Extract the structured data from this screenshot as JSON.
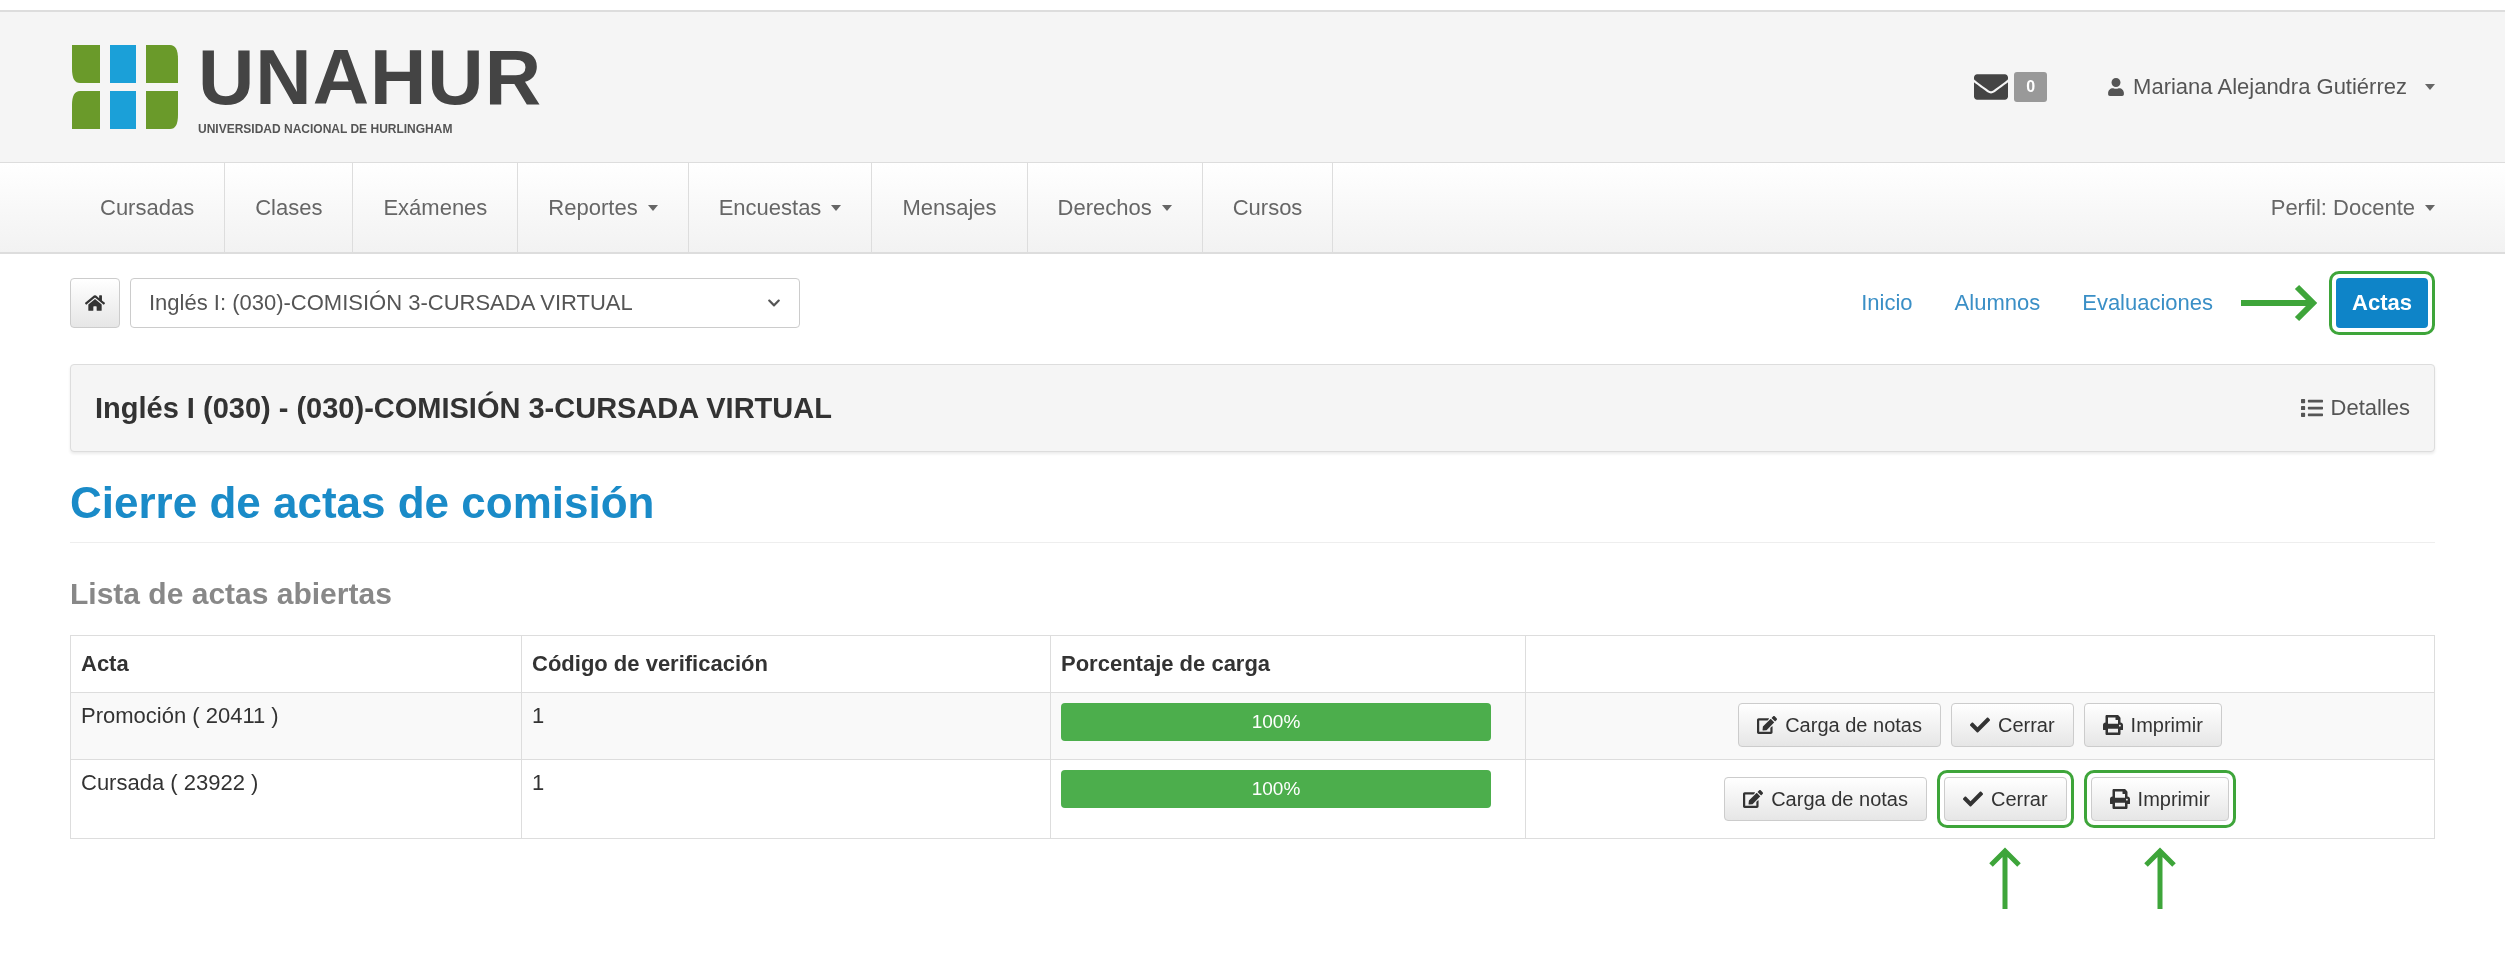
{
  "header": {
    "logo_title": "UNAHUR",
    "logo_subtitle": "UNIVERSIDAD NACIONAL DE HURLINGHAM",
    "messages_count": "0",
    "user": "Mariana Alejandra Gutiérrez"
  },
  "nav": {
    "items": [
      {
        "label": "Cursadas",
        "dropdown": false
      },
      {
        "label": "Clases",
        "dropdown": false
      },
      {
        "label": "Exámenes",
        "dropdown": false
      },
      {
        "label": "Reportes",
        "dropdown": true
      },
      {
        "label": "Encuestas",
        "dropdown": true
      },
      {
        "label": "Mensajes",
        "dropdown": false
      },
      {
        "label": "Derechos",
        "dropdown": true
      },
      {
        "label": "Cursos",
        "dropdown": false
      }
    ],
    "profile": "Perfil: Docente"
  },
  "course_select": {
    "value": "Inglés I: (030)-COMISIÓN 3-CURSADA VIRTUAL"
  },
  "subnav": [
    {
      "label": "Inicio",
      "selected": false,
      "highlighted": false
    },
    {
      "label": "Alumnos",
      "selected": false,
      "highlighted": false
    },
    {
      "label": "Evaluaciones",
      "selected": false,
      "highlighted": false
    },
    {
      "label": "Actas",
      "selected": true,
      "highlighted": true
    }
  ],
  "panel": {
    "title": "Inglés I (030) - (030)-COMISIÓN 3-CURSADA VIRTUAL",
    "details": "Detalles"
  },
  "page_title": "Cierre de actas de comisión",
  "section_title": "Lista de actas abiertas",
  "table": {
    "columns": [
      "Acta",
      "Código de verificación",
      "Porcentaje de carga"
    ],
    "rows": [
      {
        "acta": "Promoción ( 20411 )",
        "code": "1",
        "level": 1,
        "percent": "100%",
        "actions": [
          {
            "kind": "edit",
            "label": "Carga de notas",
            "highlighted": false
          },
          {
            "kind": "check",
            "label": "Cerrar",
            "highlighted": false
          },
          {
            "kind": "print",
            "label": "Imprimir",
            "highlighted": false
          }
        ]
      },
      {
        "acta": "Cursada ( 23922 )",
        "code": "1",
        "level": 1,
        "percent": "100%",
        "actions": [
          {
            "kind": "edit",
            "label": "Carga de notas",
            "highlighted": false
          },
          {
            "kind": "check",
            "label": "Cerrar",
            "highlighted": true
          },
          {
            "kind": "print",
            "label": "Imprimir",
            "highlighted": true
          }
        ]
      }
    ]
  }
}
